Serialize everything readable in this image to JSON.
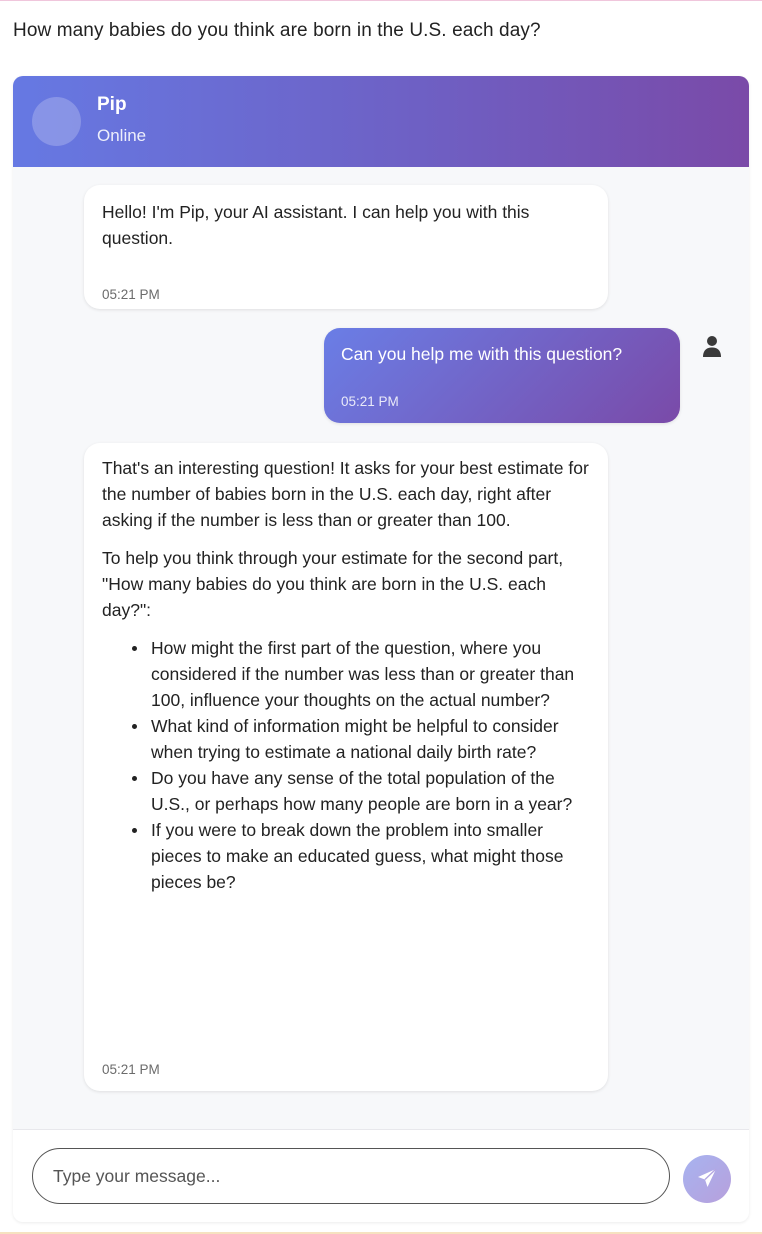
{
  "question": "How many babies do you think are born in the U.S. each day?",
  "header": {
    "name": "Pip",
    "status": "Online"
  },
  "messages": [
    {
      "sender": "bot",
      "text": "Hello! I'm Pip, your AI assistant. I can help you with this question.",
      "time": "05:21 PM"
    },
    {
      "sender": "user",
      "text": "Can you help me with this question?",
      "time": "05:21 PM"
    },
    {
      "sender": "bot",
      "paragraphs": [
        "That's an interesting question! It asks for your best estimate for the number of babies born in the U.S. each day, right after asking if the number is less than or greater than 100.",
        "To help you think through your estimate for the second part, \"How many babies do you think are born in the U.S. each day?\":"
      ],
      "bullets": [
        "How might the first part of the question, where you considered if the number was less than or greater than 100, influence your thoughts on the actual number?",
        "What kind of information might be helpful to consider when trying to estimate a national daily birth rate?",
        "Do you have any sense of the total population of the U.S., or perhaps how many people are born in a year?",
        "If you were to break down the problem into smaller pieces to make an educated guess, what might those pieces be?"
      ],
      "time": "05:21 PM"
    }
  ],
  "input": {
    "placeholder": "Type your message...",
    "value": ""
  },
  "icons": {
    "user": "user-icon",
    "send": "paper-plane-icon"
  },
  "colors": {
    "header_gradient_start": "#6679e3",
    "header_gradient_end": "#7a4aa8",
    "send_button": "#b0a9e6"
  }
}
